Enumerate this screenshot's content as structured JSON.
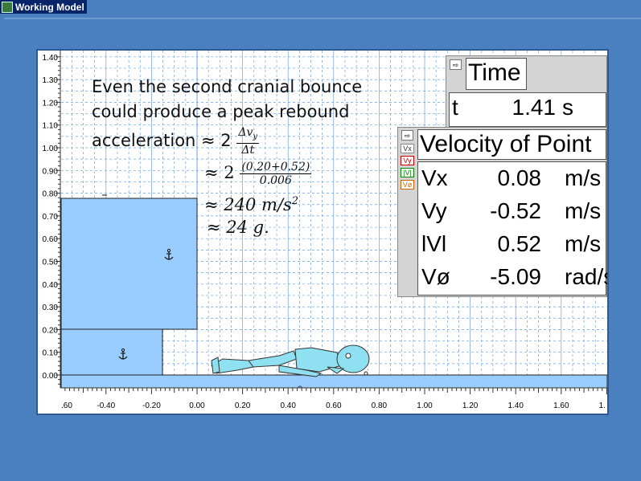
{
  "window": {
    "title": "Working Model"
  },
  "colors": {
    "block": "#99ccff",
    "grid": "#6fa0d8",
    "ground": "#99ccff"
  },
  "axes": {
    "y_ticks": [
      "1.40",
      "1.30",
      "1.20",
      "1.10",
      "1.00",
      "0.90",
      "0.80",
      "0.70",
      "0.60",
      "0.50",
      "0.40",
      "0.30",
      "0.20",
      "0.10",
      "0.00"
    ],
    "x_ticks": [
      ".60",
      "-0.40",
      "-0.20",
      "0.00",
      "0.20",
      "0.40",
      "0.60",
      "0.80",
      "1.00",
      "1.20",
      "1.40",
      "1.60",
      "1."
    ]
  },
  "annotation": {
    "line1": "Even the second cranial bounce",
    "line2": "could produce a peak rebound",
    "line3_prefix": "acceleration ≈ 2",
    "frac1_num": "Δv",
    "frac1_num_sub": "y",
    "frac1_den": "Δt",
    "line4_prefix": "≈ 2",
    "frac2_num": "(0.20+0.52)",
    "frac2_den": "0.006",
    "line5_prefix": "≈ 240 ",
    "line5_unit": "m/s",
    "line5_exp": "2",
    "line6": "≈ 24 g."
  },
  "time_meter": {
    "title": "Time",
    "label": "t",
    "value": "1.41",
    "unit": "s"
  },
  "velocity_meter": {
    "title": "Velocity of Point",
    "toggles": [
      "Vx",
      "Vy",
      "|V|",
      "Vø"
    ],
    "rows": [
      {
        "label": "Vx",
        "value": "0.08",
        "unit": "m/s"
      },
      {
        "label": "Vy",
        "value": "-0.52",
        "unit": "m/s"
      },
      {
        "label": "lVl",
        "value": "0.52",
        "unit": "m/s"
      },
      {
        "label": "Vø",
        "value": "-5.09",
        "unit": "rad/s"
      }
    ]
  },
  "icons": {
    "anchor": "anchor-icon",
    "arrow": "pointer-arrow-icon"
  }
}
